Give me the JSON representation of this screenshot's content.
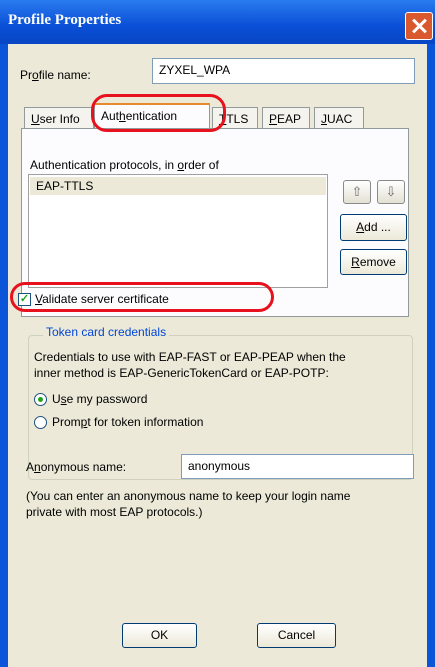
{
  "window": {
    "title": "Profile Properties"
  },
  "profile_name": {
    "label_pre": "Pr",
    "label_u": "o",
    "label_post": "file name:",
    "value": "ZYXEL_WPA"
  },
  "tabs": [
    {
      "pre": "",
      "u": "U",
      "post": "ser Info"
    },
    {
      "pre": "Aut",
      "u": "h",
      "post": "entication"
    },
    {
      "pre": "",
      "u": "T",
      "post": "TLS"
    },
    {
      "pre": "",
      "u": "P",
      "post": "EAP"
    },
    {
      "pre": "",
      "u": "J",
      "post": "UAC"
    }
  ],
  "auth": {
    "protocols_label_pre": "Authentication protocols, in ",
    "protocols_label_u": "o",
    "protocols_label_post": "rder of",
    "protocols": [
      "EAP-TTLS"
    ],
    "up_icon": "double-chevron-up-icon",
    "down_icon": "double-chevron-down-icon",
    "add_pre": "",
    "add_u": "A",
    "add_post": "dd ...",
    "remove_pre": "",
    "remove_u": "R",
    "remove_post": "emove"
  },
  "validate": {
    "checked": true,
    "pre": "",
    "u": "V",
    "post": "alidate server certificate"
  },
  "token": {
    "group_label": "Token card credentials",
    "description_line1": "Credentials to use with EAP-FAST or EAP-PEAP when the",
    "description_line2": "inner method is EAP-GenericTokenCard or EAP-POTP:",
    "use_password_pre": "U",
    "use_password_u": "s",
    "use_password_post": "e my password",
    "prompt_pre": "Prom",
    "prompt_u": "p",
    "prompt_post": "t for token information",
    "selected": "use_password"
  },
  "anonymous": {
    "label_pre": "A",
    "label_u": "n",
    "label_post": "onymous name:",
    "value": "anonymous",
    "hint_line1": "(You can enter an anonymous name to keep your login name",
    "hint_line2": "private with most EAP protocols.)"
  },
  "footer": {
    "ok_label": "OK",
    "cancel_label": "Cancel"
  },
  "colors": {
    "highlight": "#e8121e",
    "titlebar": "#0a55d8",
    "dialog": "#ece9d8"
  }
}
